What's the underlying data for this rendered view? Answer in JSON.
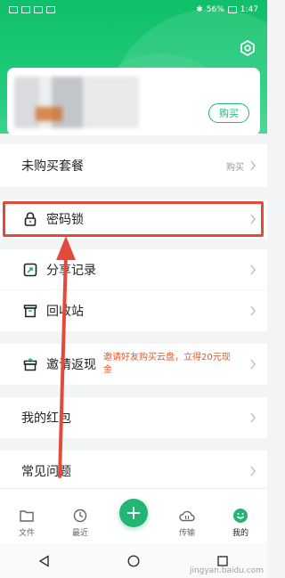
{
  "status_bar": {
    "time": "1:47",
    "battery": "56%"
  },
  "account": {
    "buy_label": "购买"
  },
  "rows": {
    "no_package": {
      "label": "未购买套餐",
      "sub": "购买"
    },
    "password_lock": {
      "label": "密码锁"
    },
    "share_record": {
      "label": "分享记录"
    },
    "recycle_bin": {
      "label": "回收站"
    },
    "invite": {
      "label": "邀请返现",
      "promo": "邀请好友购买云盘，立得20元现金"
    },
    "red_packet": {
      "label": "我的红包"
    },
    "faq": {
      "label": "常见问题"
    }
  },
  "tabs": [
    {
      "label": "文件",
      "icon": "folder-icon"
    },
    {
      "label": "最近",
      "icon": "clock-icon"
    },
    {
      "label": "",
      "icon": "plus-icon"
    },
    {
      "label": "传输",
      "icon": "cloud-transfer-icon"
    },
    {
      "label": "我的",
      "icon": "profile-icon"
    }
  ],
  "fab_symbol": "+",
  "watermark": "jingyan.baidu.com",
  "colors": {
    "accent": "#22b573",
    "highlight": "#e24b3b",
    "promo": "#e25a2a"
  }
}
